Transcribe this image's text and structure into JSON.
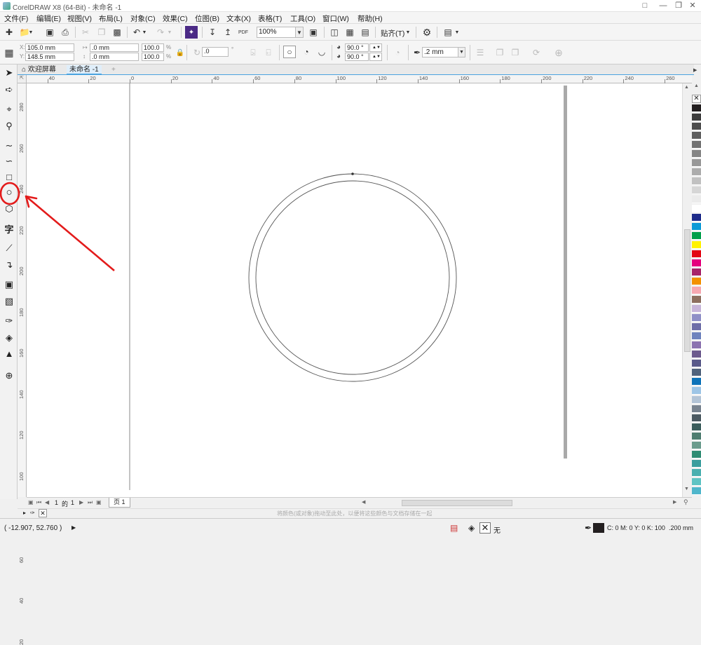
{
  "window": {
    "title": "CorelDRAW X8 (64-Bit) - 未命名 -1"
  },
  "menu": [
    "文件(F)",
    "编辑(E)",
    "视图(V)",
    "布局(L)",
    "对象(C)",
    "效果(C)",
    "位图(B)",
    "文本(X)",
    "表格(T)",
    "工具(O)",
    "窗口(W)",
    "帮助(H)"
  ],
  "toolbar": {
    "zoom": "100%",
    "snap_label": "贴齐(T)",
    "pdf_label": "PDF"
  },
  "property_bar": {
    "x": "105.0 mm",
    "y": "148.5 mm",
    "width": ".0 mm",
    "height": ".0 mm",
    "scale_x": "100.0",
    "scale_y": "100.0",
    "percent": "%",
    "rotation": ".0",
    "start_angle": "90.0 °",
    "end_angle": "90.0 °",
    "outline_width": ".2 mm"
  },
  "tabs": {
    "welcome": "欢迎屏幕",
    "document": "未命名 -1"
  },
  "hruler_labels": [
    "40",
    "20",
    "0",
    "20",
    "40",
    "60",
    "80",
    "100",
    "120",
    "140",
    "160",
    "180",
    "200",
    "220",
    "240",
    "260"
  ],
  "vruler_labels": [
    "280",
    "260",
    "240",
    "220",
    "200",
    "180",
    "160",
    "140",
    "120",
    "100",
    "80",
    "60",
    "40",
    "20"
  ],
  "ruler_unit": "毫米",
  "pager": {
    "current": "1",
    "of": "的",
    "total": "1",
    "page_tab": "页 1"
  },
  "hint": "将颜色(或对象)拖动至此处，以便将这些颜色与文档存储在一起",
  "status": {
    "coords": "( -12.907, 52.760 )",
    "fill_none": "无",
    "outline_color": "C: 0 M: 0 Y: 0 K: 100",
    "outline_width": ".200 mm"
  },
  "palette": [
    "#231f20",
    "#3d3d3d",
    "#4d4d4d",
    "#5f5f5f",
    "#727272",
    "#858585",
    "#989898",
    "#acacac",
    "#c1c1c1",
    "#d6d6d6",
    "#ebebeb",
    "#ffffff",
    "#1e2b8a",
    "#0d9bd7",
    "#00a04a",
    "#fff200",
    "#e30613",
    "#e5007e",
    "#a8246a",
    "#f39200",
    "#f6a9b2",
    "#8d6f5f",
    "#c7b5d9",
    "#8f8fc7",
    "#6e6ea8",
    "#6f83be",
    "#8c73b0",
    "#6c5a8d",
    "#5a5a8a",
    "#51637c",
    "#0e73b9",
    "#9ec5e6",
    "#b3c4d6",
    "#78838f",
    "#4c5a62",
    "#3b5d5c",
    "#4e7d70",
    "#6b9c8d",
    "#2f8c73",
    "#3b9e9e",
    "#4ab0b0",
    "#5fc4c4",
    "#4fb6cb"
  ],
  "annotation_color": "#e31b1b",
  "accent": "#4aa3df"
}
